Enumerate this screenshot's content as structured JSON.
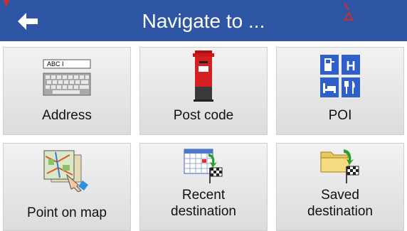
{
  "header": {
    "title": "Navigate to ...",
    "back_icon": "back-arrow-icon",
    "background": "#2f56a5"
  },
  "tiles": [
    {
      "label": "Address",
      "icon": "keyboard-icon",
      "icon_text": "ABC I"
    },
    {
      "label": "Post code",
      "icon": "postbox-icon"
    },
    {
      "label": "POI",
      "icon": "poi-services-icon",
      "icon_letters": [
        "H"
      ]
    },
    {
      "label": "Point on map",
      "icon": "map-pointer-icon"
    },
    {
      "label": "Recent destination",
      "icon": "calendar-flag-icon"
    },
    {
      "label": "Saved destination",
      "icon": "folder-flag-icon"
    }
  ]
}
